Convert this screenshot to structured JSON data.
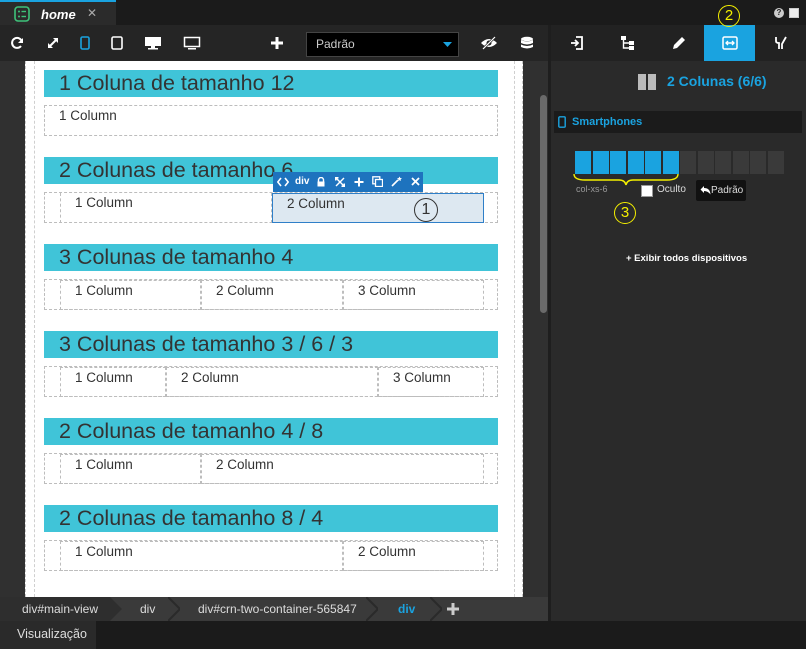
{
  "tab": {
    "title": "home",
    "close": "✕"
  },
  "toolbar": {
    "preset_select": "Padrão"
  },
  "sections": [
    {
      "title": "1 Coluna de tamanho 12",
      "columns": [
        "1 Column"
      ]
    },
    {
      "title": "2 Colunas de tamanho 6",
      "columns": [
        "1 Column",
        "2 Column"
      ]
    },
    {
      "title": "3 Colunas de tamanho 4",
      "columns": [
        "1 Column",
        "2 Column",
        "3 Column"
      ]
    },
    {
      "title": "3 Colunas de tamanho 3 / 6 / 3",
      "columns": [
        "1 Column",
        "2 Column",
        "3 Column"
      ]
    },
    {
      "title": "2 Colunas de tamanho 4 / 8",
      "columns": [
        "1 Column",
        "2 Column"
      ]
    },
    {
      "title": "2 Colunas de tamanho 8 / 4",
      "columns": [
        "1 Column",
        "2 Column"
      ]
    }
  ],
  "context_toolbar": {
    "tag": "div"
  },
  "markers": {
    "one": "1",
    "two": "2",
    "three": "3"
  },
  "breadcrumb": [
    "div#main-view",
    "div",
    "div#crn-two-container-565847",
    "div"
  ],
  "bottom": {
    "tab": "Visualização"
  },
  "panel": {
    "heading": "2 Colunas (6/6)",
    "device": "Smartphones",
    "grid": {
      "total": 12,
      "active": 6,
      "active_color": "#1aa3e0",
      "inactive_color": "#3a3a3a"
    },
    "class_label": "col-xs-6",
    "hidden_label": "Oculto",
    "default_label": "Padrão",
    "show_all": "+ Exibir todos dispositivos"
  },
  "colors": {
    "accent": "#1aa3e0",
    "section": "#40c4d8",
    "marker": "#f5f000"
  }
}
